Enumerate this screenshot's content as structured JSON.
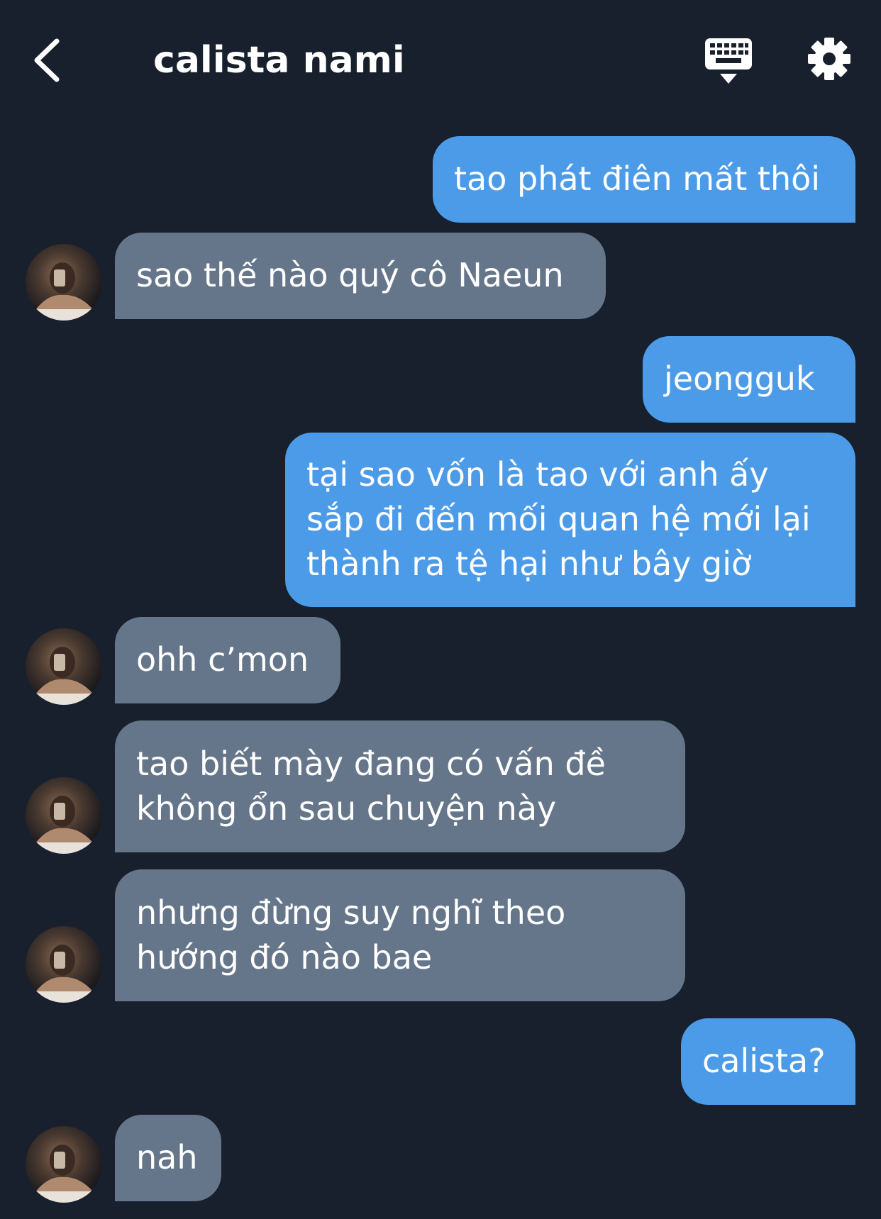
{
  "header": {
    "title": "calista nami",
    "back_icon": "chevron-left-icon",
    "keyboard_icon": "keyboard-icon",
    "settings_icon": "gear-icon"
  },
  "colors": {
    "background": "#17202c",
    "sent_bubble": "#4c9be8",
    "received_bubble": "#66768a",
    "text": "#ffffff"
  },
  "messages": [
    {
      "side": "sent",
      "lines": [
        "tao phát điên mất thôi"
      ]
    },
    {
      "side": "received",
      "lines": [
        "sao thế nào quý cô Naeun"
      ]
    },
    {
      "side": "sent",
      "lines": [
        "jeongguk"
      ]
    },
    {
      "side": "sent",
      "lines": [
        "tại sao vốn là tao với anh ấy",
        "sắp đi đến mối quan hệ mới lại",
        "thành ra tệ hại như bây giờ"
      ]
    },
    {
      "side": "received",
      "lines": [
        "ohh c’mon"
      ]
    },
    {
      "side": "received",
      "lines": [
        "tao biết mày đang có vấn đề",
        "không ổn sau chuyện này"
      ]
    },
    {
      "side": "received",
      "lines": [
        "nhưng đừng suy nghĩ theo",
        "hướng đó nào bae"
      ]
    },
    {
      "side": "sent",
      "lines": [
        "calista?"
      ]
    },
    {
      "side": "received",
      "lines": [
        "nah"
      ]
    }
  ]
}
